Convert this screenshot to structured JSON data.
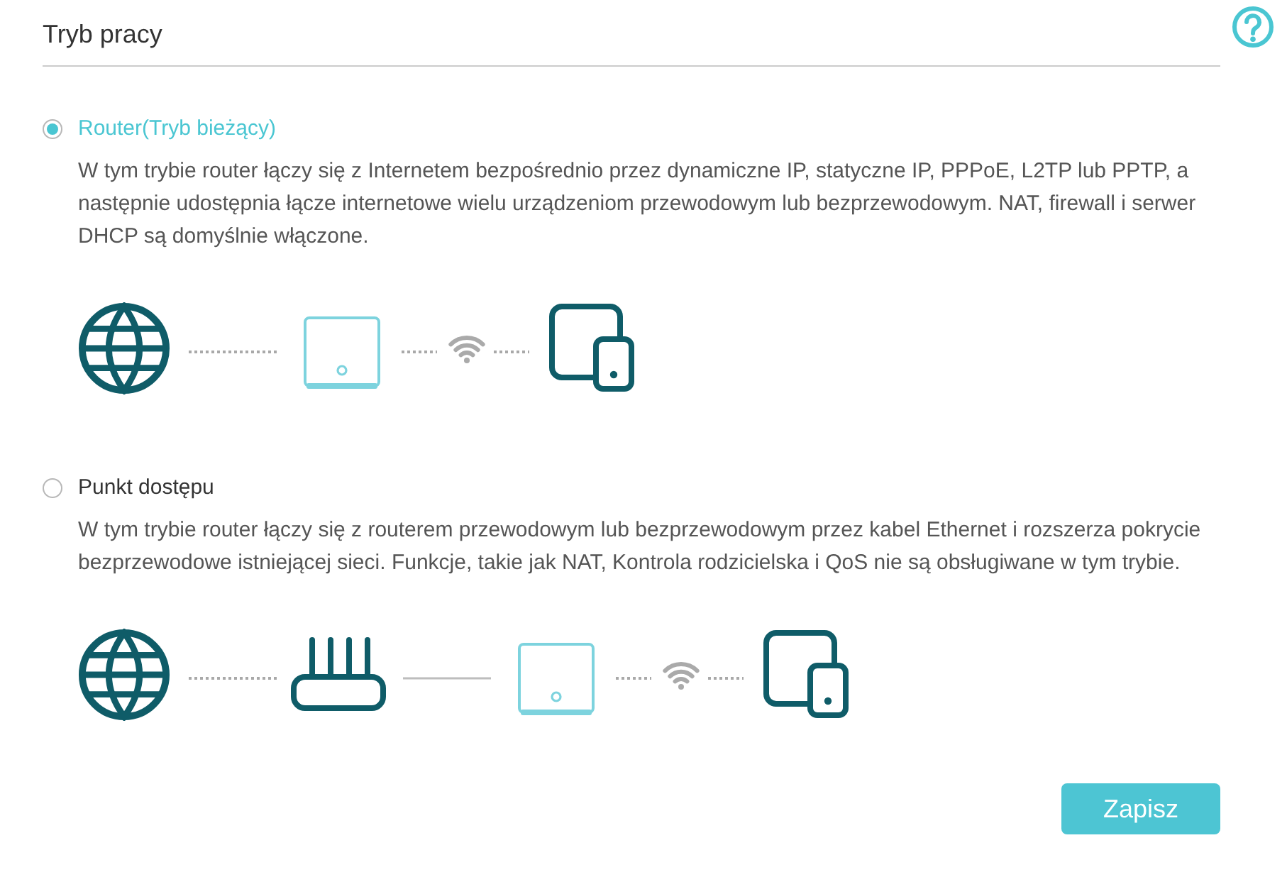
{
  "page": {
    "title": "Tryb pracy"
  },
  "modes": [
    {
      "label": "Router(Tryb bieżący)",
      "selected": true,
      "description": "W tym trybie router łączy się z Internetem bezpośrednio przez dynamiczne IP, statyczne IP, PPPoE, L2TP lub PPTP, a następnie udostępnia łącze internetowe wielu urządzeniom przewodowym lub bezprzewodowym. NAT, firewall i serwer DHCP są domyślnie włączone.",
      "diagram": [
        {
          "kind": "globe"
        },
        {
          "kind": "dotted"
        },
        {
          "kind": "unit"
        },
        {
          "kind": "dotted"
        },
        {
          "kind": "wifi"
        },
        {
          "kind": "dotted"
        },
        {
          "kind": "devices"
        }
      ]
    },
    {
      "label": "Punkt dostępu",
      "selected": false,
      "description": "W tym trybie router łączy się z routerem przewodowym lub bezprzewodowym przez kabel Ethernet i rozszerza pokrycie bezprzewodowe istniejącej sieci. Funkcje, takie jak NAT, Kontrola rodzicielska i QoS nie są obsługiwane w tym trybie.",
      "diagram": [
        {
          "kind": "globe"
        },
        {
          "kind": "dotted"
        },
        {
          "kind": "router"
        },
        {
          "kind": "cable"
        },
        {
          "kind": "unit"
        },
        {
          "kind": "dotted"
        },
        {
          "kind": "wifi"
        },
        {
          "kind": "dotted"
        },
        {
          "kind": "devices"
        }
      ]
    }
  ],
  "buttons": [
    {
      "label": "Zapisz"
    }
  ]
}
